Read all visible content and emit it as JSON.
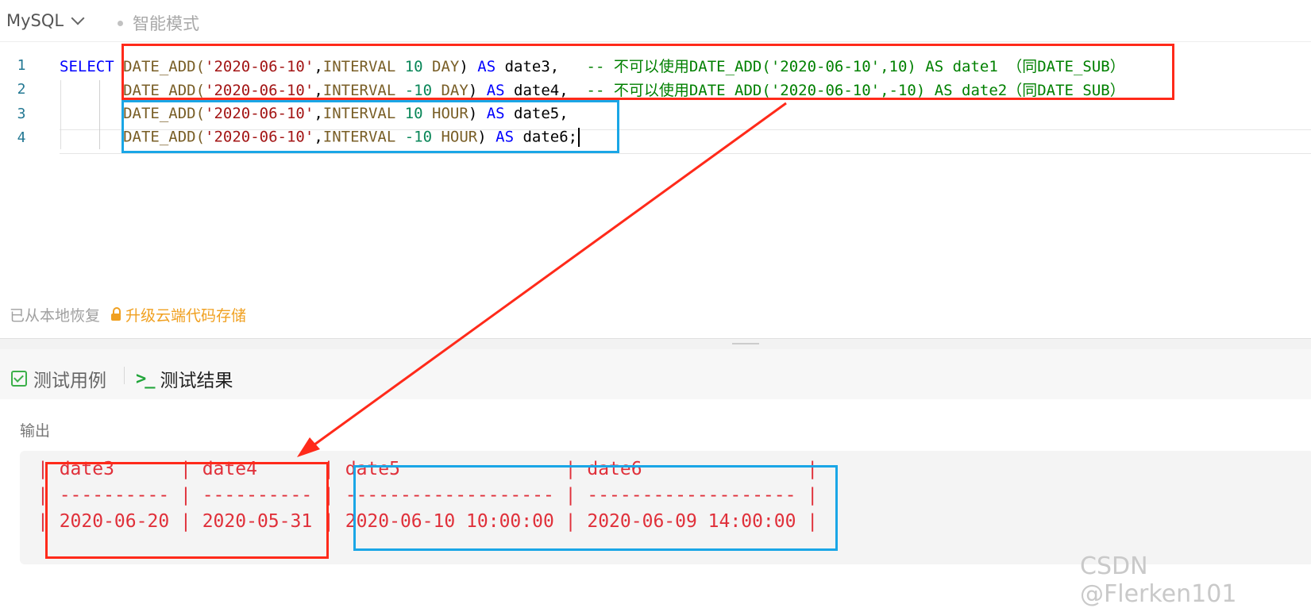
{
  "topbar": {
    "language": "MySQL",
    "mode": "智能模式"
  },
  "editor": {
    "lines": [
      {
        "no": "1",
        "tokens": [
          {
            "t": "kw",
            "v": "SELECT "
          },
          {
            "t": "fn",
            "v": "DATE_ADD("
          },
          {
            "t": "str",
            "v": "'2020-06-10'"
          },
          {
            "t": "txt",
            "v": ","
          },
          {
            "t": "fn",
            "v": "INTERVAL "
          },
          {
            "t": "num",
            "v": "10"
          },
          {
            "t": "fn",
            "v": " DAY"
          },
          {
            "t": "txt",
            "v": ") "
          },
          {
            "t": "kw",
            "v": "AS"
          },
          {
            "t": "txt",
            "v": " date3,   "
          },
          {
            "t": "cmt",
            "v": "-- 不可以使用DATE_ADD('2020-06-10',10) AS date1 （同DATE_SUB）"
          }
        ]
      },
      {
        "no": "2",
        "tokens": [
          {
            "t": "txt",
            "v": "       "
          },
          {
            "t": "fn",
            "v": "DATE_ADD("
          },
          {
            "t": "str",
            "v": "'2020-06-10'"
          },
          {
            "t": "txt",
            "v": ","
          },
          {
            "t": "fn",
            "v": "INTERVAL "
          },
          {
            "t": "num",
            "v": "-10"
          },
          {
            "t": "fn",
            "v": " DAY"
          },
          {
            "t": "txt",
            "v": ") "
          },
          {
            "t": "kw",
            "v": "AS"
          },
          {
            "t": "txt",
            "v": " date4,  "
          },
          {
            "t": "cmt",
            "v": "-- 不可以使用DATE_ADD('2020-06-10',-10) AS date2（同DATE_SUB）"
          }
        ]
      },
      {
        "no": "3",
        "tokens": [
          {
            "t": "txt",
            "v": "       "
          },
          {
            "t": "fn",
            "v": "DATE_ADD("
          },
          {
            "t": "str",
            "v": "'2020-06-10'"
          },
          {
            "t": "txt",
            "v": ","
          },
          {
            "t": "fn",
            "v": "INTERVAL "
          },
          {
            "t": "num",
            "v": "10"
          },
          {
            "t": "fn",
            "v": " HOUR"
          },
          {
            "t": "txt",
            "v": ") "
          },
          {
            "t": "kw",
            "v": "AS"
          },
          {
            "t": "txt",
            "v": " date5,"
          }
        ]
      },
      {
        "no": "4",
        "tokens": [
          {
            "t": "txt",
            "v": "       "
          },
          {
            "t": "fn",
            "v": "DATE_ADD("
          },
          {
            "t": "str",
            "v": "'2020-06-10'"
          },
          {
            "t": "txt",
            "v": ","
          },
          {
            "t": "fn",
            "v": "INTERVAL "
          },
          {
            "t": "num",
            "v": "-10"
          },
          {
            "t": "fn",
            "v": " HOUR"
          },
          {
            "t": "txt",
            "v": ") "
          },
          {
            "t": "kw",
            "v": "AS"
          },
          {
            "t": "txt",
            "v": " date6;"
          }
        ]
      }
    ],
    "status_restored": "已从本地恢复",
    "status_upgrade": "升级云端代码存储"
  },
  "tabs": {
    "cases": "测试用例",
    "result": "测试结果",
    "result_icon": ">_"
  },
  "output": {
    "label": "输出",
    "header_row": "| date3      | date4      | date5               | date6               |",
    "separator_row": "| ---------- | ---------- | ------------------- | ------------------- |",
    "value_row": "| 2020-06-20 | 2020-05-31 | 2020-06-10 10:00:00 | 2020-06-09 14:00:00 |"
  },
  "watermark": "CSDN @Flerken101",
  "colors": {
    "annotation_red": "#ff2a1a",
    "annotation_blue": "#1aa6e6",
    "keyword": "#0000ff",
    "string": "#a31515",
    "comment": "#008000",
    "output_text": "#e0303a"
  }
}
